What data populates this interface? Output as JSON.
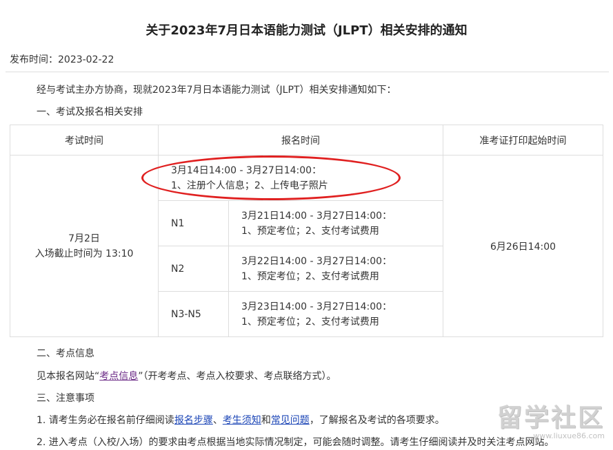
{
  "title": "关于2023年7月日本语能力测试（JLPT）相关安排的通知",
  "publish": "发布时间：2023-02-22",
  "intro": "经与考试主办方协商，现就2023年7月日本语能力测试（JLPT）相关安排通知如下：",
  "section1": "一、考试及报名相关安排",
  "table": {
    "headers": [
      "考试时间",
      "报名时间",
      "准考证打印起始时间"
    ],
    "exam_date": "7月2日",
    "exam_cutoff": "入场截止时间为 13:10",
    "print_time": "6月26日14:00",
    "first": {
      "time": "3月14日14:00 - 3月27日14:00：",
      "desc": "1、注册个人信息；2、上传电子照片"
    },
    "levels": [
      {
        "level": "N1",
        "time": "3月21日14:00 - 3月27日14:00：",
        "desc": "1、预定考位；2、支付考试费用"
      },
      {
        "level": "N2",
        "time": "3月22日14:00 - 3月27日14:00：",
        "desc": "1、预定考位；2、支付考试费用"
      },
      {
        "level": "N3-N5",
        "time": "3月23日14:00 - 3月27日14:00：",
        "desc": "1、预定考位；2、支付考试费用"
      }
    ]
  },
  "section2": "二、考点信息",
  "venue": {
    "prefix": "见本报名网站",
    "quote_open": "“",
    "link": "考点信息",
    "quote_close": "”",
    "suffix": "（开考考点、考点入校要求、考点联络方式）。"
  },
  "section3": "三、注意事项",
  "note1": {
    "prefix": "1. 请考生务必在报名前仔细阅读",
    "link1": "报名步骤",
    "sep1": "、",
    "link2": "考生须知",
    "sep2": "和",
    "link3": "常见问题",
    "suffix": "，了解报名及考试的各项要求。"
  },
  "note2": "2. 进入考点（入校/入场）的要求由考点根据当地实际情况制定，可能会随时调整。请考生仔细阅读并及时关注考点网站。",
  "watermark": {
    "text": "留学社区",
    "url": "www.liuxue86.com"
  }
}
